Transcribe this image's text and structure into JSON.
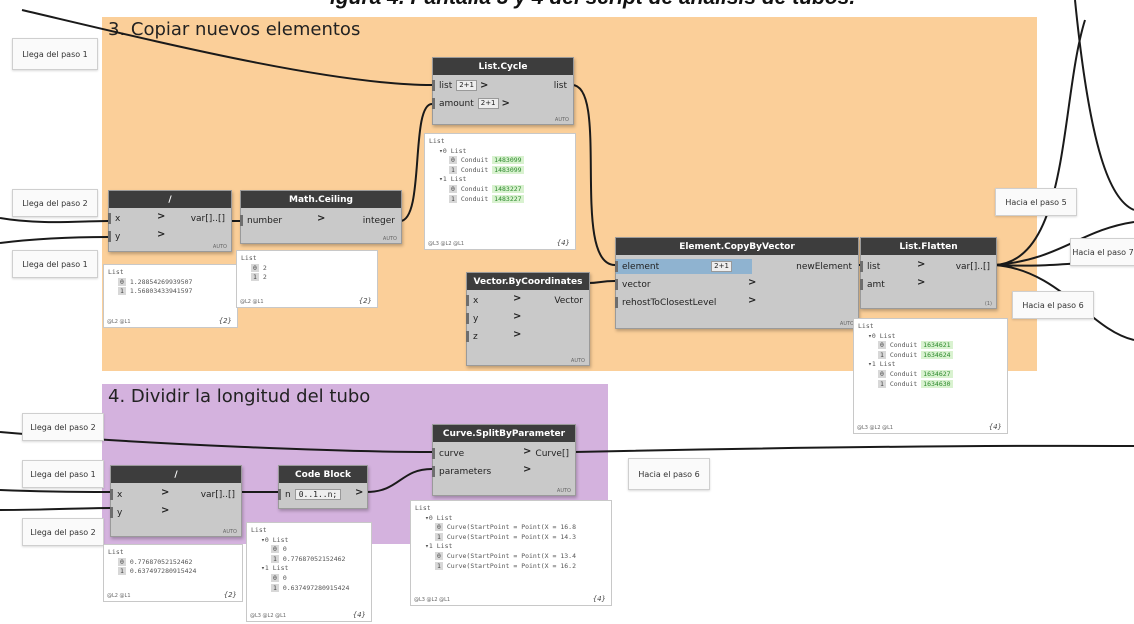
{
  "caption": "igura 4. Pantalla 3 y 4 del script de análisis de tubos.",
  "groups": {
    "g3": {
      "title": "3. Copiar nuevos elementos",
      "color": "#fbcf99"
    },
    "g4": {
      "title": "4. Dividir la longitud del tubo",
      "color": "#d4b2de"
    }
  },
  "notes": {
    "n1": "Llega del paso 1",
    "n2": "Llega del paso 2",
    "n3": "Llega del paso 1",
    "n4": "Llega del paso 2",
    "n5": "Llega del paso 1",
    "n6": "Llega del paso 2",
    "n7": "Hacia el paso 5",
    "n8": "Hacia el paso 7",
    "n9": "Hacia el paso 6",
    "n10": "Hacia el paso 6"
  },
  "nodes": {
    "listCycle": {
      "title": "List.Cycle",
      "in": [
        "list",
        "amount"
      ],
      "out": "list",
      "spin": "2+1",
      "lacing": "AUTO"
    },
    "divide1": {
      "title": "/",
      "in": [
        "x",
        "y"
      ],
      "out": "var[]..[]",
      "lacing": "AUTO"
    },
    "mathCeiling": {
      "title": "Math.Ceiling",
      "in": [
        "number"
      ],
      "out": "integer",
      "lacing": "AUTO"
    },
    "copyByVector": {
      "title": "Element.CopyByVector",
      "in": [
        "element",
        "vector",
        "rehostToClosestLevel"
      ],
      "out": "newElement",
      "spin": "2+1",
      "lacing": "AUTO"
    },
    "vectorByCoords": {
      "title": "Vector.ByCoordinates",
      "in": [
        "x",
        "y",
        "z"
      ],
      "out": "Vector",
      "lacing": "AUTO"
    },
    "listFlatten": {
      "title": "List.Flatten",
      "in": [
        "list",
        "amt"
      ],
      "out": "var[]..[]",
      "lacing": "(1)"
    },
    "curveSplit": {
      "title": "Curve.SplitByParameter",
      "in": [
        "curve",
        "parameters"
      ],
      "out": "Curve[]",
      "lacing": "AUTO"
    },
    "divide2": {
      "title": "/",
      "in": [
        "x",
        "y"
      ],
      "out": "var[]..[]",
      "lacing": "AUTO"
    },
    "codeBlock": {
      "title": "Code Block",
      "in": [
        "n"
      ],
      "code": "0..1..n;",
      "lacing": ""
    }
  },
  "previews": {
    "pCycle": {
      "lines": [
        {
          "t": "List"
        },
        {
          "t": "▾0 List",
          "i": 1
        },
        {
          "idx": "0",
          "t": "Conduit",
          "v": "1483099",
          "i": 2
        },
        {
          "idx": "1",
          "t": "Conduit",
          "v": "1483099",
          "i": 2
        },
        {
          "t": "▾1 List",
          "i": 1
        },
        {
          "idx": "0",
          "t": "Conduit",
          "v": "1483227",
          "i": 2
        },
        {
          "idx": "1",
          "t": "Conduit",
          "v": "1483227",
          "i": 2
        }
      ],
      "foot": "@L3 @L2 @L1",
      "count": "{4}"
    },
    "pDivide1": {
      "lines": [
        {
          "t": "List"
        },
        {
          "idx": "0",
          "t": "1.28854269939507",
          "i": 1
        },
        {
          "idx": "1",
          "t": "1.56803433941597",
          "i": 1
        }
      ],
      "foot": "@L2 @L1",
      "count": "{2}"
    },
    "pCeiling": {
      "lines": [
        {
          "t": "List"
        },
        {
          "idx": "0",
          "t": "2",
          "i": 1
        },
        {
          "idx": "1",
          "t": "2",
          "i": 1
        }
      ],
      "foot": "@L2 @L1",
      "count": "{2}"
    },
    "pFlatten": {
      "lines": [
        {
          "t": "List"
        },
        {
          "t": "▾0 List",
          "i": 1
        },
        {
          "idx": "0",
          "t": "Conduit",
          "v": "1634621",
          "i": 2
        },
        {
          "idx": "1",
          "t": "Conduit",
          "v": "1634624",
          "i": 2
        },
        {
          "t": "▾1 List",
          "i": 1
        },
        {
          "idx": "0",
          "t": "Conduit",
          "v": "1634627",
          "i": 2
        },
        {
          "idx": "1",
          "t": "Conduit",
          "v": "1634630",
          "i": 2
        }
      ],
      "foot": "@L3 @L2 @L1",
      "count": "{4}"
    },
    "pDivide2": {
      "lines": [
        {
          "t": "List"
        },
        {
          "idx": "0",
          "t": "0.77687052152462",
          "i": 1
        },
        {
          "idx": "1",
          "t": "0.637497280915424",
          "i": 1
        }
      ],
      "foot": "@L2 @L1",
      "count": "{2}"
    },
    "pCode": {
      "lines": [
        {
          "t": "List"
        },
        {
          "t": "▾0 List",
          "i": 1
        },
        {
          "idx": "0",
          "t": "0",
          "i": 2
        },
        {
          "idx": "1",
          "t": "0.77687052152462",
          "i": 2
        },
        {
          "t": "▾1 List",
          "i": 1
        },
        {
          "idx": "0",
          "t": "0",
          "i": 2
        },
        {
          "idx": "1",
          "t": "0.637497280915424",
          "i": 2
        }
      ],
      "foot": "@L3 @L2 @L1",
      "count": "{4}"
    },
    "pSplit": {
      "lines": [
        {
          "t": "List"
        },
        {
          "t": "▾0 List",
          "i": 1
        },
        {
          "idx": "0",
          "t": "Curve(StartPoint = Point(X = 16.8",
          "i": 2
        },
        {
          "idx": "1",
          "t": "Curve(StartPoint = Point(X = 14.3",
          "i": 2
        },
        {
          "t": "▾1 List",
          "i": 1
        },
        {
          "idx": "0",
          "t": "Curve(StartPoint = Point(X = 13.4",
          "i": 2
        },
        {
          "idx": "1",
          "t": "Curve(StartPoint = Point(X = 16.2",
          "i": 2
        }
      ],
      "foot": "@L3 @L2 @L1",
      "count": "{4}"
    }
  }
}
